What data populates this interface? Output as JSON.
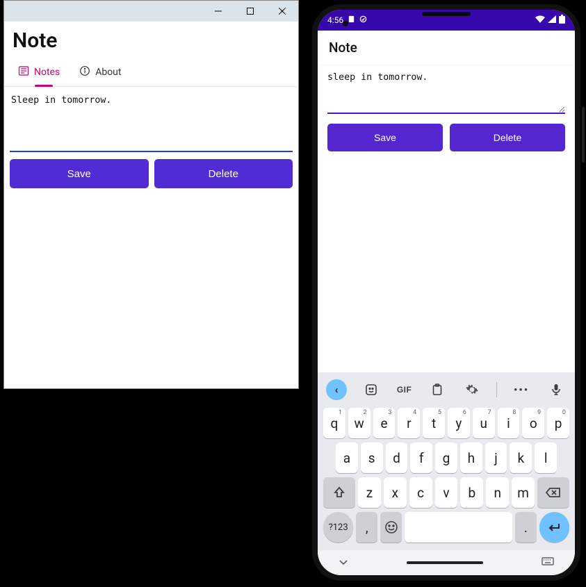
{
  "windows": {
    "title": "Note",
    "tabs": [
      {
        "label": "Notes",
        "icon": "notes-icon",
        "active": true
      },
      {
        "label": "About",
        "icon": "info-icon",
        "active": false
      }
    ],
    "editor_value": "Sleep in tomorrow.",
    "buttons": {
      "save": "Save",
      "delete": "Delete"
    }
  },
  "phone": {
    "status": {
      "time": "4:56"
    },
    "title": "Note",
    "editor_value": "sleep in tomorrow.",
    "buttons": {
      "save": "Save",
      "delete": "Delete"
    },
    "keyboard": {
      "toolbar_gif": "GIF",
      "row1": [
        {
          "k": "q",
          "s": "1"
        },
        {
          "k": "w",
          "s": "2"
        },
        {
          "k": "e",
          "s": "3"
        },
        {
          "k": "r",
          "s": "4"
        },
        {
          "k": "t",
          "s": "5"
        },
        {
          "k": "y",
          "s": "6"
        },
        {
          "k": "u",
          "s": "7"
        },
        {
          "k": "i",
          "s": "8"
        },
        {
          "k": "o",
          "s": "9"
        },
        {
          "k": "p",
          "s": "0"
        }
      ],
      "row2": [
        "a",
        "s",
        "d",
        "f",
        "g",
        "h",
        "j",
        "k",
        "l"
      ],
      "row3": [
        "z",
        "x",
        "c",
        "v",
        "b",
        "n",
        "m"
      ],
      "sym": "?123",
      "comma": ",",
      "period": "."
    }
  }
}
